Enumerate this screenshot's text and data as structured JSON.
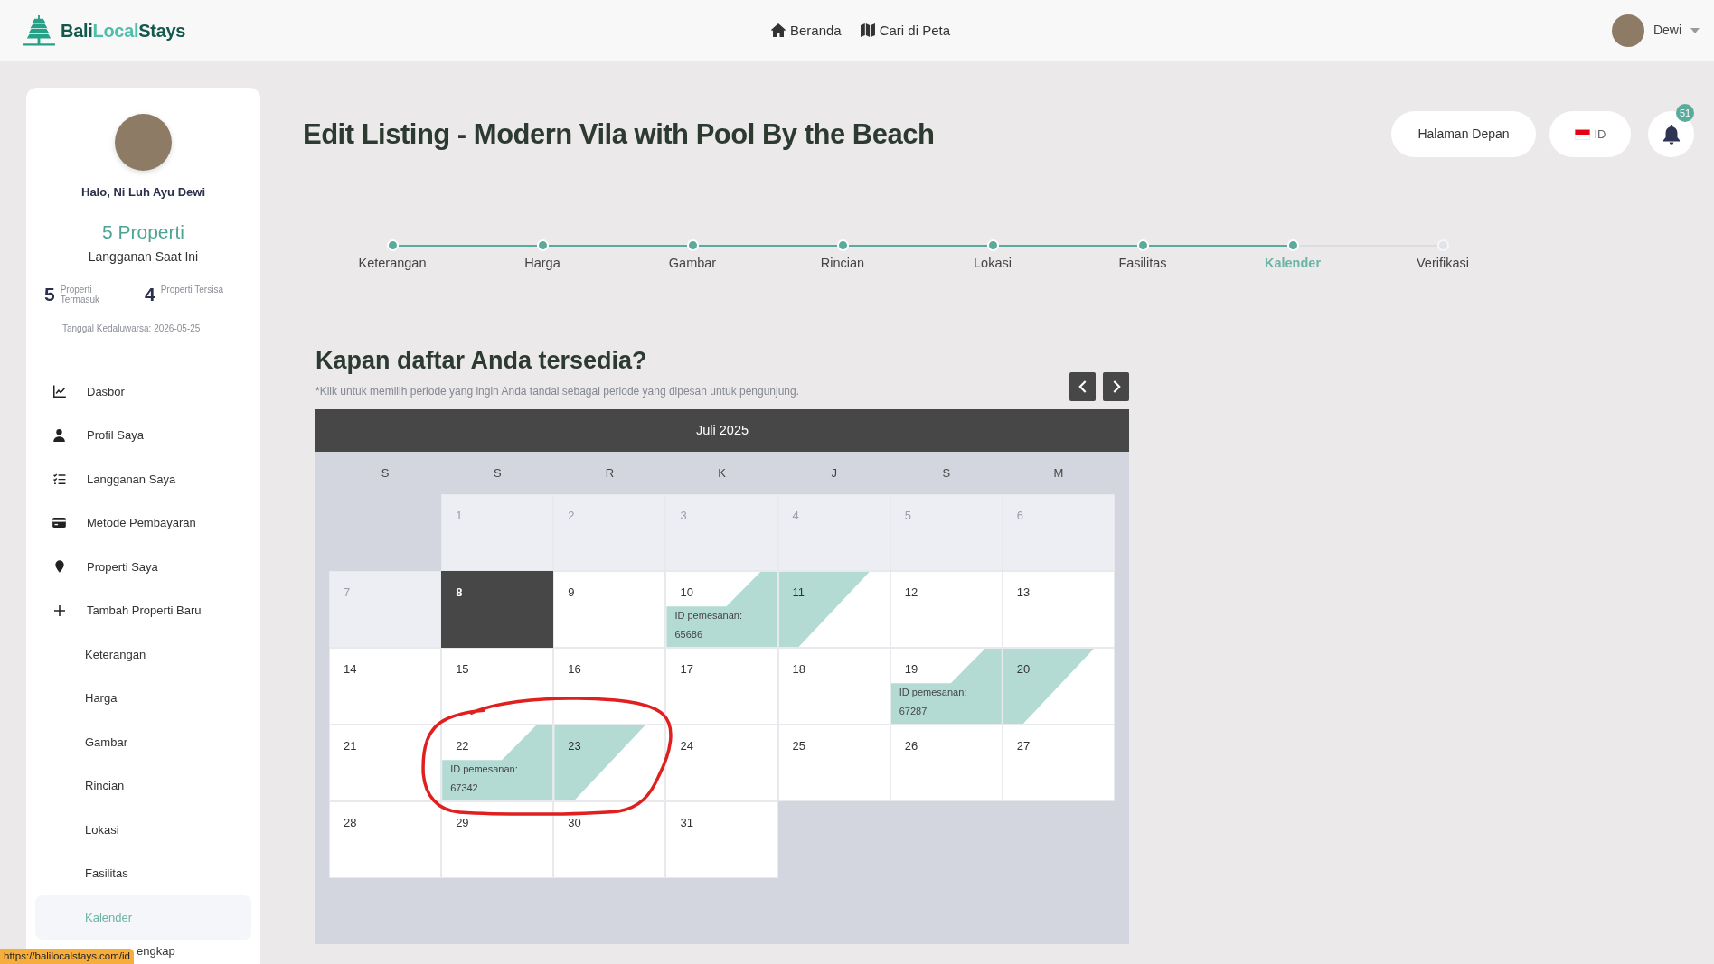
{
  "navbar": {
    "logo": [
      {
        "text": "Bali",
        "accent": false
      },
      {
        "text": "Local",
        "accent": true
      },
      {
        "text": "Stays",
        "accent": false
      }
    ],
    "links": [
      "Beranda",
      "Cari di Peta"
    ],
    "user": "Dewi"
  },
  "sidebar": {
    "greeting": "Halo, Ni Luh Ayu Dewi",
    "plan": "5 Properti",
    "plan_caption": "Langganan Saat Ini",
    "stats": [
      {
        "value": "5",
        "label": "Properti Termasuk"
      },
      {
        "value": "4",
        "label": "Properti Tersisa"
      }
    ],
    "expiry": "Tanggal Kedaluwarsa: 2026-05-25",
    "items": [
      {
        "label": "Dasbor",
        "kind": "main",
        "selected": false
      },
      {
        "label": "Profil Saya",
        "kind": "main",
        "selected": false
      },
      {
        "label": "Langganan Saya",
        "kind": "main",
        "selected": false
      },
      {
        "label": "Metode Pembayaran",
        "kind": "main",
        "selected": false
      },
      {
        "label": "Properti Saya",
        "kind": "main",
        "selected": false
      },
      {
        "label": "Tambah Properti Baru",
        "kind": "main",
        "selected": false
      },
      {
        "label": "Keterangan",
        "kind": "sub",
        "selected": false
      },
      {
        "label": "Harga",
        "kind": "sub",
        "selected": false
      },
      {
        "label": "Gambar",
        "kind": "sub",
        "selected": false
      },
      {
        "label": "Rincian",
        "kind": "sub",
        "selected": false
      },
      {
        "label": "Lokasi",
        "kind": "sub",
        "selected": false
      },
      {
        "label": "Fasilitas",
        "kind": "sub",
        "selected": false
      },
      {
        "label": "Kalender",
        "kind": "sub",
        "selected": true
      },
      {
        "label": "engkap",
        "kind": "sub",
        "selected": false
      }
    ]
  },
  "header": {
    "title": "Edit Listing - Modern Vila with Pool By the Beach",
    "home_button": "Halaman Depan",
    "language": "ID",
    "notification_count": "51"
  },
  "steps": [
    {
      "label": "Keterangan",
      "completed": true,
      "selected": false
    },
    {
      "label": "Harga",
      "completed": true,
      "selected": false
    },
    {
      "label": "Gambar",
      "completed": true,
      "selected": false
    },
    {
      "label": "Rincian",
      "completed": true,
      "selected": false
    },
    {
      "label": "Lokasi",
      "completed": true,
      "selected": false
    },
    {
      "label": "Fasilitas",
      "completed": true,
      "selected": false
    },
    {
      "label": "Kalender",
      "completed": true,
      "selected": true
    },
    {
      "label": "Verifikasi",
      "completed": false,
      "selected": false
    }
  ],
  "availability": {
    "heading": "Kapan daftar Anda tersedia?",
    "hint": "*Klik untuk memilih periode yang ingin Anda tandai sebagai periode yang dipesan untuk pengunjung.",
    "calendar": {
      "month": "Juli 2025",
      "weekdays": [
        "S",
        "S",
        "R",
        "K",
        "J",
        "S",
        "M"
      ],
      "weeks": [
        {
          "days": [
            {
              "kind": "blank"
            },
            {
              "day": "1",
              "kind": "past",
              "circled": false
            },
            {
              "day": "2",
              "kind": "past",
              "circled": false
            },
            {
              "day": "3",
              "kind": "past",
              "circled": false
            },
            {
              "day": "4",
              "kind": "past",
              "circled": false
            },
            {
              "day": "5",
              "kind": "past",
              "circled": false
            },
            {
              "day": "6",
              "kind": "past",
              "circled": false
            }
          ]
        },
        {
          "days": [
            {
              "day": "7",
              "kind": "past",
              "circled": false
            },
            {
              "day": "8",
              "kind": "today",
              "circled": false
            },
            {
              "day": "9",
              "kind": "open",
              "circled": false
            },
            {
              "day": "10",
              "kind": "booking-start",
              "booking_label": "ID pemesanan:",
              "booking_id": "65686",
              "circled": false
            },
            {
              "day": "11",
              "kind": "booking-end",
              "circled": false
            },
            {
              "day": "12",
              "kind": "open",
              "circled": false
            },
            {
              "day": "13",
              "kind": "open",
              "circled": false
            }
          ]
        },
        {
          "days": [
            {
              "day": "14",
              "kind": "open",
              "circled": false
            },
            {
              "day": "15",
              "kind": "open",
              "circled": false
            },
            {
              "day": "16",
              "kind": "open",
              "circled": false
            },
            {
              "day": "17",
              "kind": "open",
              "circled": false
            },
            {
              "day": "18",
              "kind": "open",
              "circled": false
            },
            {
              "day": "19",
              "kind": "booking-start",
              "booking_label": "ID pemesanan:",
              "booking_id": "67287",
              "circled": false
            },
            {
              "day": "20",
              "kind": "booking-end",
              "circled": false
            }
          ]
        },
        {
          "days": [
            {
              "day": "21",
              "kind": "open",
              "circled": false
            },
            {
              "day": "22",
              "kind": "booking-start",
              "booking_label": "ID pemesanan:",
              "booking_id": "67342",
              "circled": true
            },
            {
              "day": "23",
              "kind": "booking-end",
              "circled": true
            },
            {
              "day": "24",
              "kind": "open",
              "circled": false
            },
            {
              "day": "25",
              "kind": "open",
              "circled": false
            },
            {
              "day": "26",
              "kind": "open",
              "circled": false
            },
            {
              "day": "27",
              "kind": "open",
              "circled": false
            }
          ]
        },
        {
          "days": [
            {
              "day": "28",
              "kind": "open",
              "circled": false
            },
            {
              "day": "29",
              "kind": "open",
              "circled": false
            },
            {
              "day": "30",
              "kind": "open",
              "circled": false
            },
            {
              "day": "31",
              "kind": "open",
              "circled": false
            },
            {
              "kind": "blank"
            },
            {
              "kind": "blank"
            },
            {
              "kind": "blank"
            }
          ]
        }
      ]
    }
  },
  "status_link": "https://balilocalstays.com/id"
}
